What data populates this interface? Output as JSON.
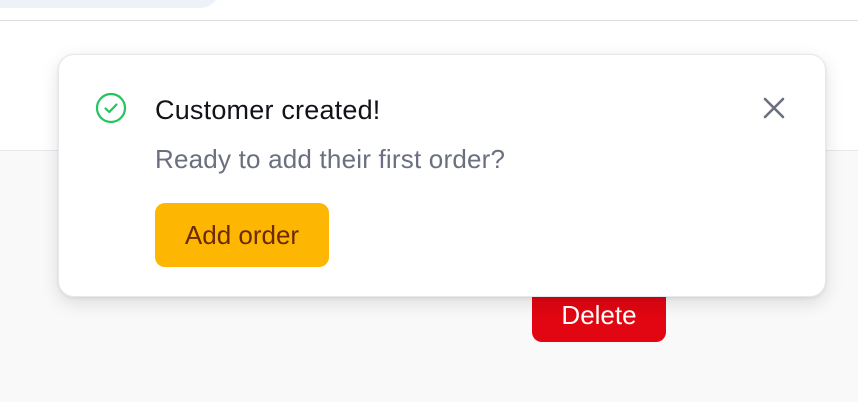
{
  "toast": {
    "title": "Customer created!",
    "message": "Ready to add their first order?",
    "action_label": "Add order",
    "status_icon": "check-circle-icon",
    "close_icon": "close-icon",
    "success_color": "#22c55e",
    "action_color": "#fdb702"
  },
  "background": {
    "delete_label": "Delete",
    "delete_color": "#e10612"
  }
}
